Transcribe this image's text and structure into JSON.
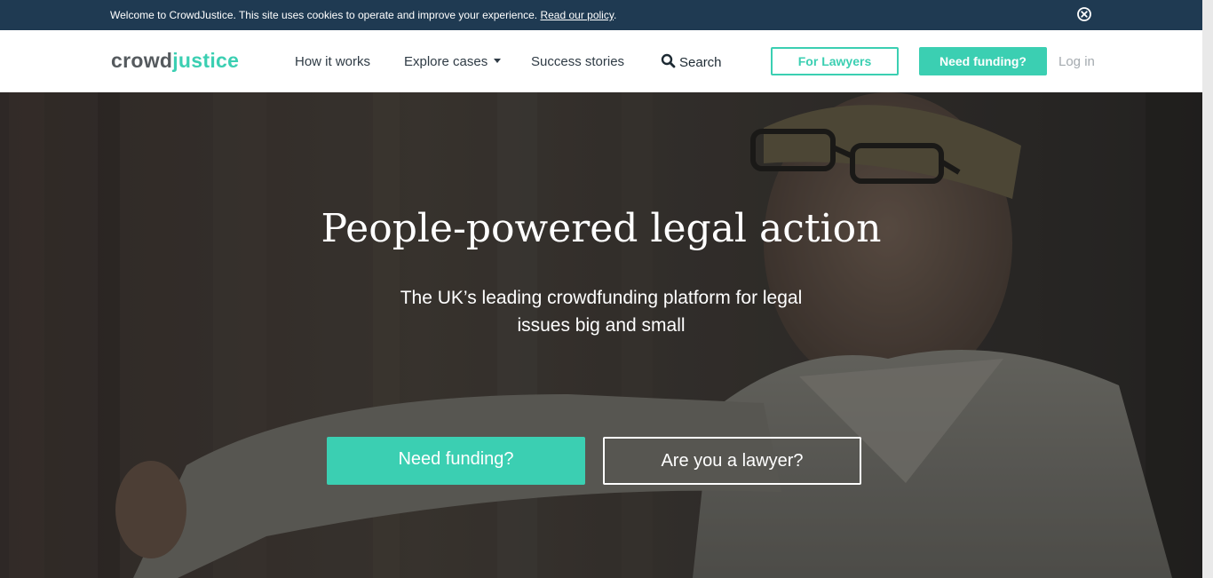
{
  "cookie_bar": {
    "message": "Welcome to CrowdJustice. This site uses cookies to operate and improve your experience.",
    "link_label": "Read our policy",
    "after_link": ".",
    "close_icon": "close-circle-icon"
  },
  "nav": {
    "logo_part1": "crowd",
    "logo_part2": "justice",
    "how_it_works": "How it works",
    "explore_cases": "Explore cases",
    "success_stories": "Success stories",
    "search": "Search",
    "for_lawyers": "For Lawyers",
    "need_funding": "Need funding?",
    "log_in": "Log in"
  },
  "hero": {
    "title": "People-powered legal action",
    "subtitle": "The UK’s leading crowdfunding platform for legal issues big and small",
    "btn_funding": "Need funding?",
    "btn_lawyer": "Are you a lawyer?"
  },
  "colors": {
    "accent": "#3bcfb2",
    "cookie_bar": "#1f3a52",
    "logo_gray": "#555a5e",
    "muted": "#a4aaaf"
  }
}
